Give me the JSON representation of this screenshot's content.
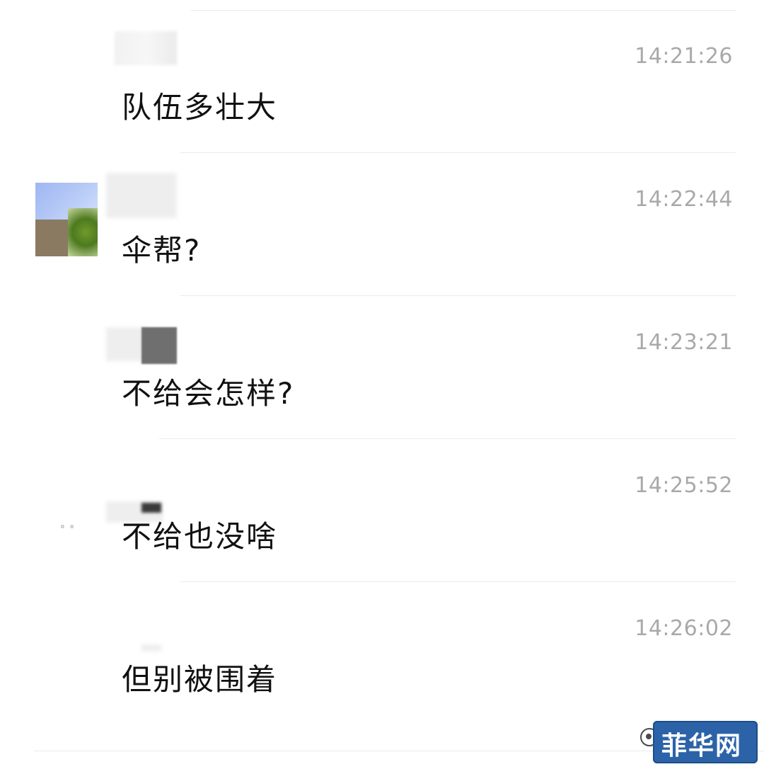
{
  "messages": [
    {
      "time": "14:21:26",
      "text": "队伍多壮大"
    },
    {
      "time": "14:22:44",
      "text": "伞帮?"
    },
    {
      "time": "14:23:21",
      "text": "不给会怎样?"
    },
    {
      "time": "14:25:52",
      "text": "不给也没啥"
    },
    {
      "time": "14:26:02",
      "text": "但别被围着"
    }
  ],
  "watermark": {
    "text": "菲华网"
  }
}
